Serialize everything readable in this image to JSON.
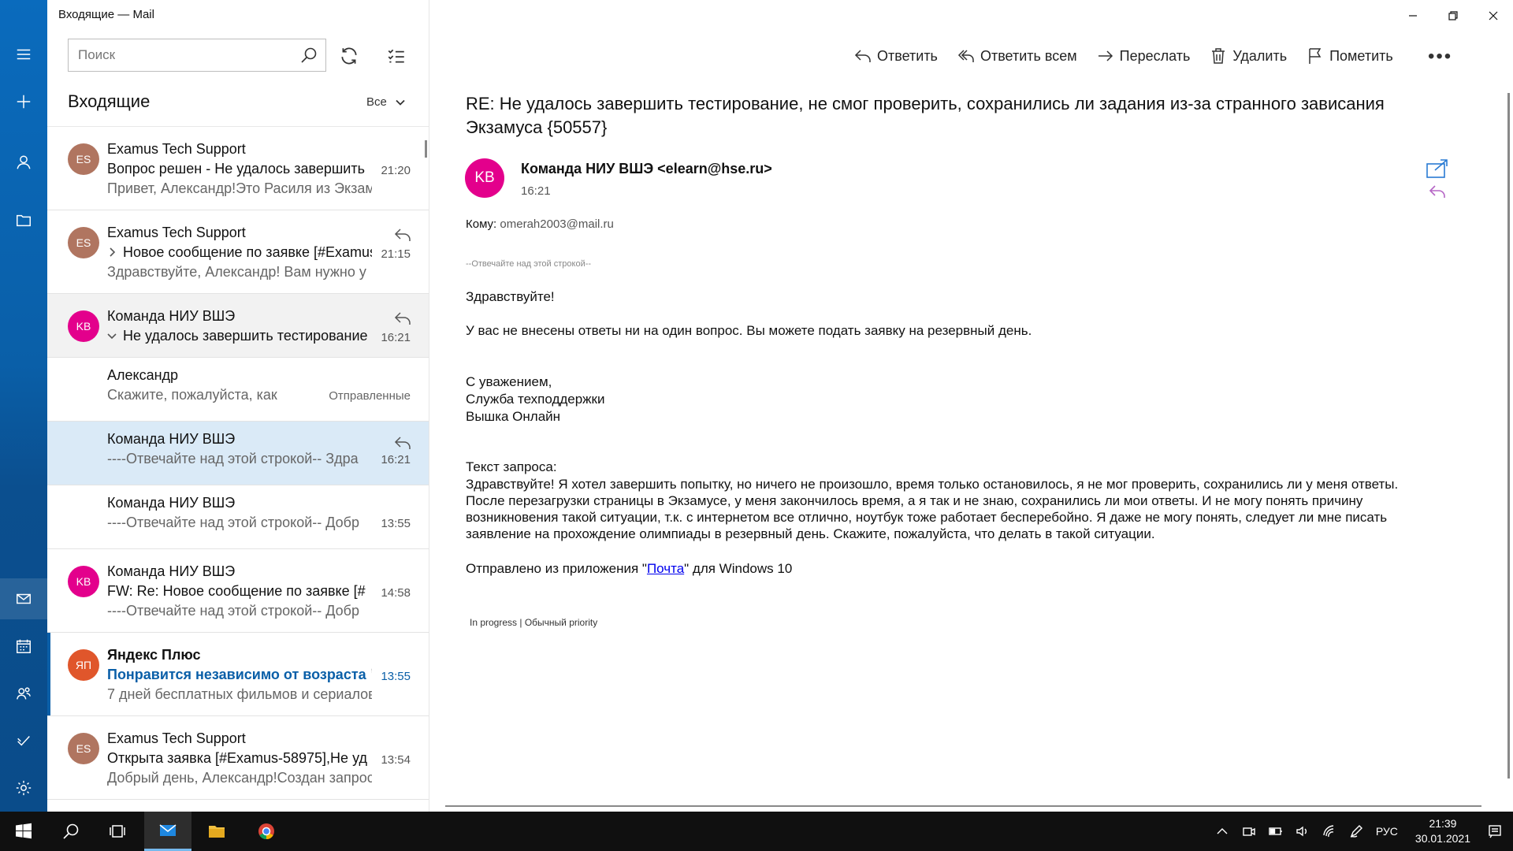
{
  "window": {
    "title": "Входящие — Mail"
  },
  "search": {
    "placeholder": "Поиск"
  },
  "folder": {
    "name": "Входящие",
    "filter_label": "Все"
  },
  "messages": [
    {
      "avatar": "ES",
      "avatar_color": "#b07560",
      "sender": "Examus Tech Support",
      "subject": "Вопрос решен - Не удалось завершить",
      "preview": "Привет, Александр!Это Расиля из Экзамуса",
      "time": "21:20"
    },
    {
      "avatar": "ES",
      "avatar_color": "#b07560",
      "sender": "Examus Tech Support",
      "subject": "Новое сообщение по заявке [#Examus",
      "preview": "Здравствуйте, Александр! Вам нужно у",
      "time": "21:15"
    },
    {
      "avatar": "KB",
      "avatar_color": "#e3008c",
      "sender": "Команда НИУ ВШЭ",
      "subject": "Не удалось завершить тестирование",
      "preview": "",
      "time": "16:21"
    },
    {
      "sender": "Александр",
      "subject": "Скажите, пожалуйста, как узна",
      "folder_tag": "Отправленные"
    },
    {
      "sender": "Команда НИУ ВШЭ",
      "subject": "----Отвечайте над этой строкой-- Здра",
      "time": "16:21"
    },
    {
      "sender": "Команда НИУ ВШЭ",
      "subject": "----Отвечайте над этой строкой-- Добр",
      "time": "13:55"
    },
    {
      "avatar": "KB",
      "avatar_color": "#e3008c",
      "sender": "Команда НИУ ВШЭ",
      "subject": "FW: Re: Новое сообщение по заявке [#",
      "preview": "----Отвечайте над этой строкой-- Добр",
      "time": "14:58"
    },
    {
      "avatar": "ЯП",
      "avatar_color": "#e0562b",
      "sender": "Яндекс Плюс",
      "subject": "Понравится независимо от возраста 🎬",
      "preview": "7 дней бесплатных фильмов и сериалов",
      "time": "13:55"
    },
    {
      "avatar": "ES",
      "avatar_color": "#b07560",
      "sender": "Examus Tech Support",
      "subject": "Открыта заявка [#Examus-58975],Не уд",
      "preview": "Добрый день, Александр!Создан запрос",
      "time": "13:54"
    }
  ],
  "toolbar": {
    "reply": "Ответить",
    "reply_all": "Ответить всем",
    "forward": "Переслать",
    "delete": "Удалить",
    "flag": "Пометить",
    "more": "•••"
  },
  "mail": {
    "subject": "RE: Не удалось завершить тестирование, не смог проверить, сохранились ли задания из-за странного зависания Экзамуса {50557}",
    "avatar": "KB",
    "from": "Команда НИУ ВШЭ <elearn@hse.ru>",
    "sent_time": "16:21",
    "to_label": "Кому:",
    "to_address": "omerah2003@mail.ru",
    "reply_marker": "--Отвечайте над этой строкой--",
    "greeting": "Здравствуйте!",
    "p1": "У вас не внесены ответы ни на один вопрос. Вы можете подать заявку на резервный день.",
    "sign1": "С уважением,",
    "sign2": "Служба техподдержки",
    "sign3": "Вышка Онлайн",
    "req_label": "Текст запроса:",
    "req1": "Здравствуйте! Я хотел завершить попытку, но ничего не произошло, время только остановилось, я не мог проверить, сохранились ли у меня ответы.",
    "req2": "После перезагрузки страницы в Экзамусе, у меня закончилось время, а я так и не знаю, сохранились ли мои ответы. И не могу понять причину",
    "req3": "возникновения такой ситуации, т.к. с интернетом все отлично, ноутбук тоже работает бесперебойно. Я даже не могу понять, следует ли мне писать",
    "req4": "заявление на прохождение олимпиады в резервный день. Скажите, пожалуйста, что делать в такой ситуации.",
    "sent_from_pre": "Отправлено из приложения \"",
    "sent_from_link": "Почта",
    "sent_from_post": "\" для Windows 10",
    "status": "In progress | Обычный priority"
  },
  "taskbar": {
    "lang": "РУС",
    "time": "21:39",
    "date": "30.01.2021"
  },
  "colors": {
    "accent": "#0a5fa8",
    "rail": "#0a5fa8",
    "selected_blue": "#daeaf7"
  }
}
